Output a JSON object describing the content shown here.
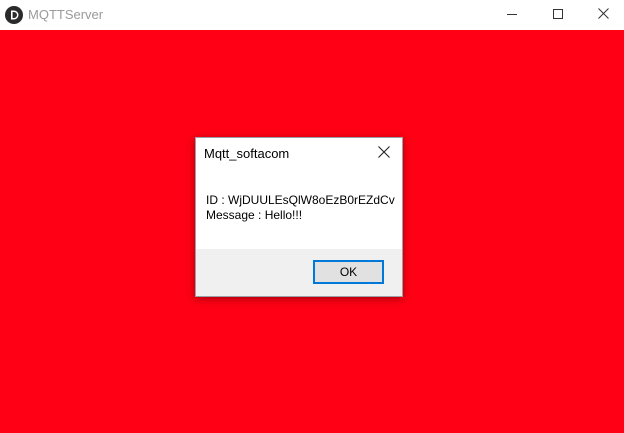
{
  "window": {
    "title": "MQTTServer",
    "background_color": "#ff0014",
    "icons": {
      "app": "app-logo-icon",
      "minimize": "minimize-icon",
      "maximize": "maximize-icon",
      "close": "close-icon"
    }
  },
  "dialog": {
    "title": "Mqtt_softacom",
    "id_line": "ID : WjDUULEsQlW8oEzB0rEZdCv",
    "message_line": "Message : Hello!!!",
    "ok_label": "OK",
    "close_icon": "close-icon"
  }
}
